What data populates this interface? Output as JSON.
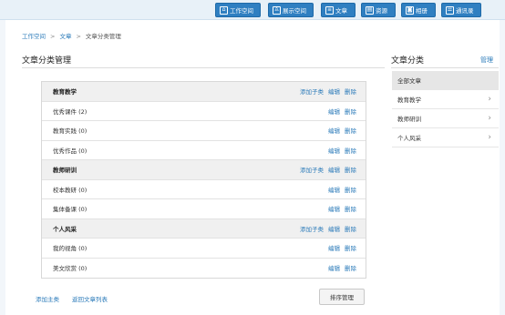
{
  "topnav": [
    {
      "label": "工作空间",
      "icon": "home-icon"
    },
    {
      "label": "展示空间",
      "icon": "user-icon"
    },
    {
      "label": "文章",
      "icon": "document-icon"
    },
    {
      "label": "资源",
      "icon": "file-icon"
    },
    {
      "label": "相册",
      "icon": "camera-icon"
    },
    {
      "label": "通讯录",
      "icon": "contacts-icon"
    }
  ],
  "breadcrumb": {
    "item1": "工作空间",
    "sep": ">",
    "item2": "文章",
    "current": "文章分类管理"
  },
  "page_title": "文章分类管理",
  "table": {
    "rows": [
      {
        "name": "教育教学",
        "parent": true
      },
      {
        "name": "优秀课件 (2)",
        "parent": false
      },
      {
        "name": "教育实践 (0)",
        "parent": false
      },
      {
        "name": "优秀作品 (0)",
        "parent": false
      },
      {
        "name": "教师研训",
        "parent": true
      },
      {
        "name": "校本教研 (0)",
        "parent": false
      },
      {
        "name": "集体备课 (0)",
        "parent": false
      },
      {
        "name": "个人风采",
        "parent": true
      },
      {
        "name": "我的视角 (0)",
        "parent": false
      },
      {
        "name": "美文欣赏 (0)",
        "parent": false
      }
    ],
    "add_sub_label": "添加子类",
    "edit_label": "编辑",
    "delete_label": "删除"
  },
  "footer": {
    "add_main": "添加主类",
    "back": "返回文章列表",
    "sort": "排序管理"
  },
  "sidebar": {
    "title": "文章分类",
    "manage": "管理",
    "items": [
      {
        "label": "全部文章",
        "active": true,
        "chevron": false
      },
      {
        "label": "教育教学",
        "active": false,
        "chevron": true
      },
      {
        "label": "教师研训",
        "active": false,
        "chevron": true
      },
      {
        "label": "个人风采",
        "active": false,
        "chevron": true
      }
    ]
  },
  "colors": {
    "nav_blue": "#2f7fc1",
    "link_blue": "#2a7ab9",
    "parent_row_bg": "#f0f0f0"
  }
}
